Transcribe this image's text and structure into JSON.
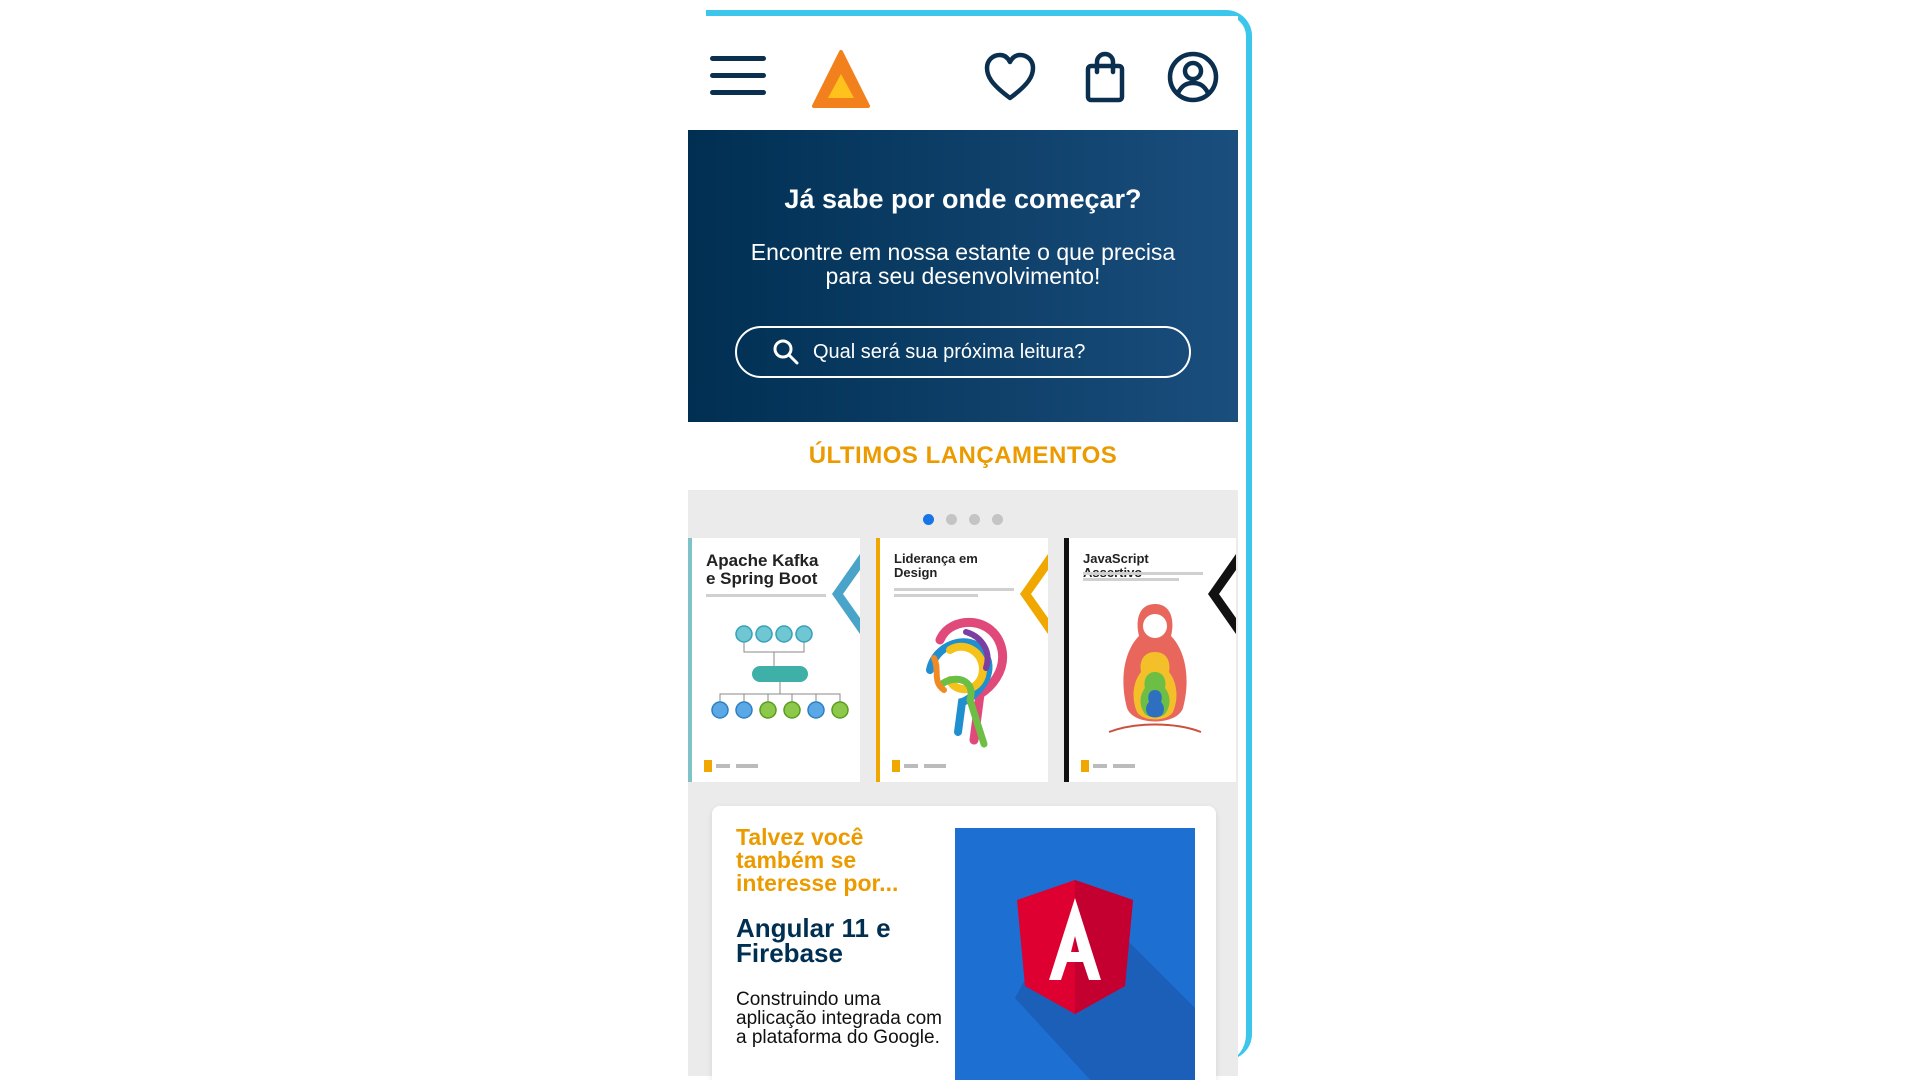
{
  "header": {
    "menu_icon": "hamburger-menu-icon",
    "logo_icon": "triangle-logo-icon",
    "favorites_icon": "heart-icon",
    "bag_icon": "shopping-bag-icon",
    "user_icon": "user-account-icon"
  },
  "hero": {
    "title": "Já sabe por onde começar?",
    "subtitle": "Encontre em nossa estante o que precisa para seu desenvolvimento!",
    "search_placeholder": "Qual será sua próxima leitura?",
    "search_icon": "search-icon"
  },
  "launches": {
    "title": "ÚLTIMOS LANÇAMENTOS",
    "dots": 4,
    "active_dot": 1,
    "books": [
      {
        "title": "Apache Kafka e Spring Boot",
        "accent": "#4aa3c8"
      },
      {
        "title": "Liderança em Design",
        "accent": "#f0a800"
      },
      {
        "title": "JavaScript Assertivo",
        "accent": "#111111"
      }
    ]
  },
  "suggestion": {
    "tag": "Talvez você também se interesse por...",
    "title": "Angular 11 e Firebase",
    "description": "Construindo uma aplicação integrada com a plataforma do Google.",
    "image_icon": "angular-logo-icon"
  },
  "colors": {
    "brand_orange": "#eb9b00",
    "navy": "#002f52",
    "frame_cyan": "#3cc6ec",
    "dot_active": "#1875e8"
  }
}
